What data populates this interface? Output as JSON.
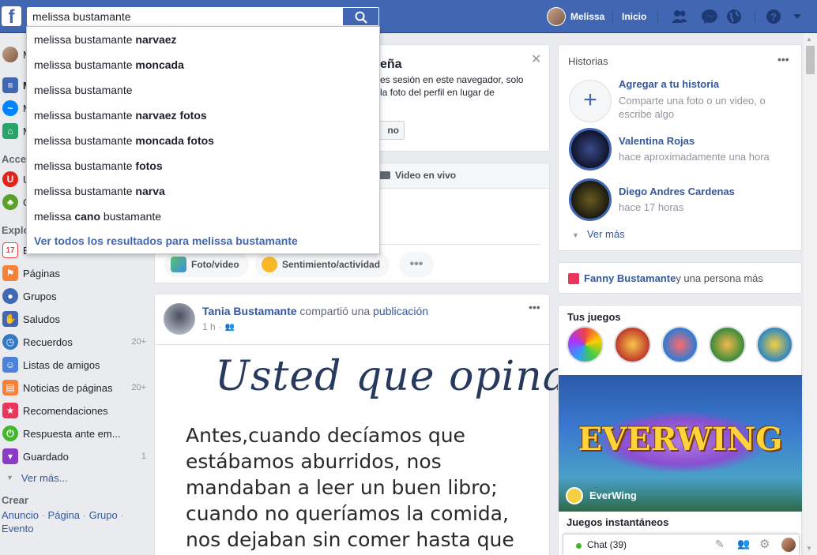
{
  "topbar": {
    "search_value": "melissa bustamante",
    "user_name": "Melissa",
    "home_label": "Inicio"
  },
  "search_dropdown": {
    "suggestions": [
      {
        "base": "melissa bustamante ",
        "bold": "narvaez"
      },
      {
        "base": "melissa bustamante ",
        "bold": "moncada"
      },
      {
        "base": "melissa bustamante",
        "bold": ""
      },
      {
        "base": "melissa bustamante ",
        "bold": "narvaez fotos"
      },
      {
        "base": "melissa bustamante ",
        "bold": "moncada fotos"
      },
      {
        "base": "melissa bustamante ",
        "bold": "fotos"
      },
      {
        "base": "melissa bustamante ",
        "bold": "narva"
      }
    ],
    "special": {
      "pre": "melissa ",
      "bold": "cano",
      "post": " bustamante"
    },
    "see_all": "Ver todos los resultados para melissa bustamante"
  },
  "left": {
    "partial": {
      "m1": "M",
      "m2": "M",
      "m3": "M",
      "m4": "M",
      "acce": "Acce",
      "u": "U",
      "g": "G",
      "explo": "Explo",
      "e": "E"
    },
    "items": [
      {
        "label": "Páginas",
        "count": ""
      },
      {
        "label": "Grupos",
        "count": ""
      },
      {
        "label": "Saludos",
        "count": ""
      },
      {
        "label": "Recuerdos",
        "count": "20+"
      },
      {
        "label": "Listas de amigos",
        "count": ""
      },
      {
        "label": "Noticias de páginas",
        "count": "20+"
      },
      {
        "label": "Recomendaciones",
        "count": ""
      },
      {
        "label": "Respuesta ante em...",
        "count": ""
      },
      {
        "label": "Guardado",
        "count": "1"
      }
    ],
    "see_more": "Ver más...",
    "create_heading": "Crear",
    "create_links": [
      "Anuncio",
      "Página",
      "Grupo",
      "Evento"
    ]
  },
  "center": {
    "notice": {
      "title_fragment": "eña",
      "line1": "es sesión en este navegador, solo",
      "line2": "la foto del perfil en lugar de",
      "button_fragment": "no"
    },
    "composer": {
      "live_video": "Video en vivo",
      "photo_video": "Foto/video",
      "feeling": "Sentimiento/actividad"
    },
    "post": {
      "author": "Tania Bustamante",
      "action": " compartió una ",
      "object": "publicación",
      "time": "1 h",
      "image_title": "Usted que opina?",
      "image_text": "Antes,cuando decíamos que estábamos aburridos, nos mandaban a leer un buen libro; cuando no queríamos la comida, nos dejaban sin comer hasta que nos diera hambre;"
    }
  },
  "right": {
    "stories_title": "Historias",
    "add_story_title": "Agregar a tu historia",
    "add_story_sub": "Comparte una foto o un video, o escribe algo",
    "stories": [
      {
        "name": "Valentina Rojas",
        "time": "hace aproximadamente una hora"
      },
      {
        "name": "Diego Andres Cardenas",
        "time": "hace 17 horas"
      }
    ],
    "see_more": "Ver más",
    "birthday_name": "Fanny Bustamante",
    "birthday_rest": " y una persona más",
    "games_title": "Tus juegos",
    "featured_game": "EverWing",
    "featured_game_logo": "EVERWING",
    "instant_games": "Juegos instantáneos",
    "chat_label": "Chat (39)"
  }
}
